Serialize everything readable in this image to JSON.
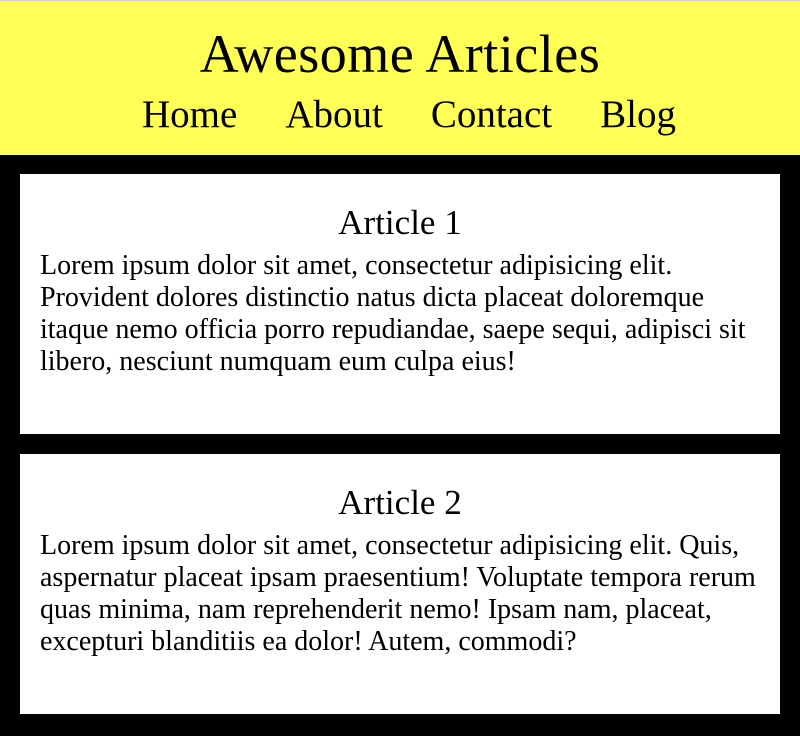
{
  "header": {
    "title": "Awesome Articles",
    "nav": [
      {
        "label": "Home"
      },
      {
        "label": "About"
      },
      {
        "label": "Contact"
      },
      {
        "label": "Blog"
      }
    ],
    "background_color": "#ffff55"
  },
  "page": {
    "background_color": "#000000"
  },
  "articles": [
    {
      "title": "Article 1",
      "body": "Lorem ipsum dolor sit amet, consectetur adipisicing elit. Provident dolores distinctio natus dicta placeat doloremque itaque nemo officia porro repudiandae, saepe sequi, adipisci sit libero, nesciunt numquam eum culpa eius!"
    },
    {
      "title": "Article 2",
      "body": "Lorem ipsum dolor sit amet, consectetur adipisicing elit. Quis, aspernatur placeat ipsam praesentium! Voluptate tempora rerum quas minima, nam reprehenderit nemo! Ipsam nam, placeat, excepturi blanditiis ea dolor! Autem, commodi?"
    }
  ]
}
